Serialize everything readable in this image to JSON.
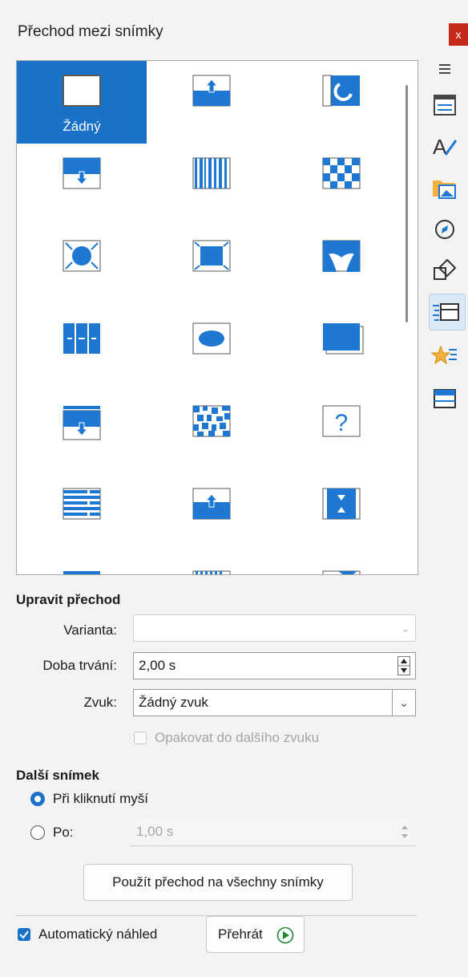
{
  "window": {
    "title": "Přechod mezi snímky",
    "close_label": "x"
  },
  "gallery": {
    "items": [
      {
        "name": "none-transition",
        "label": "Žádný",
        "selected": true
      },
      {
        "name": "wipe-up"
      },
      {
        "name": "roll"
      },
      {
        "name": "wipe-down"
      },
      {
        "name": "bars"
      },
      {
        "name": "checkers"
      },
      {
        "name": "shape-circle"
      },
      {
        "name": "box"
      },
      {
        "name": "curtain"
      },
      {
        "name": "split"
      },
      {
        "name": "oval"
      },
      {
        "name": "cover"
      },
      {
        "name": "push-down"
      },
      {
        "name": "dissolve"
      },
      {
        "name": "random"
      },
      {
        "name": "lines"
      },
      {
        "name": "uncover-up"
      },
      {
        "name": "zoom-in"
      }
    ]
  },
  "sidebar": {
    "items": [
      {
        "name": "menu-icon"
      },
      {
        "name": "properties-icon"
      },
      {
        "name": "styles-icon"
      },
      {
        "name": "gallery-icon"
      },
      {
        "name": "navigator-icon"
      },
      {
        "name": "shapes-icon"
      },
      {
        "name": "slide-transition-icon",
        "active": true
      },
      {
        "name": "animation-icon"
      },
      {
        "name": "master-slides-icon"
      }
    ]
  },
  "modify": {
    "heading": "Upravit přechod",
    "variant_label": "Varianta:",
    "variant_value": "",
    "duration_label": "Doba trvání:",
    "duration_value": "2,00 s",
    "sound_label": "Zvuk:",
    "sound_value": "Žádný zvuk",
    "loop_label": "Opakovat do dalšího zvuku"
  },
  "next": {
    "heading": "Další snímek",
    "on_click_label": "Při kliknutí myší",
    "after_label": "Po:",
    "after_value": "1,00 s"
  },
  "apply_all_label": "Použít přechod na všechny snímky",
  "autopreview_label": "Automatický náhled",
  "play_label": "Přehrát",
  "colors": {
    "accent": "#1a72c8",
    "icon_blue": "#1e78d2"
  }
}
